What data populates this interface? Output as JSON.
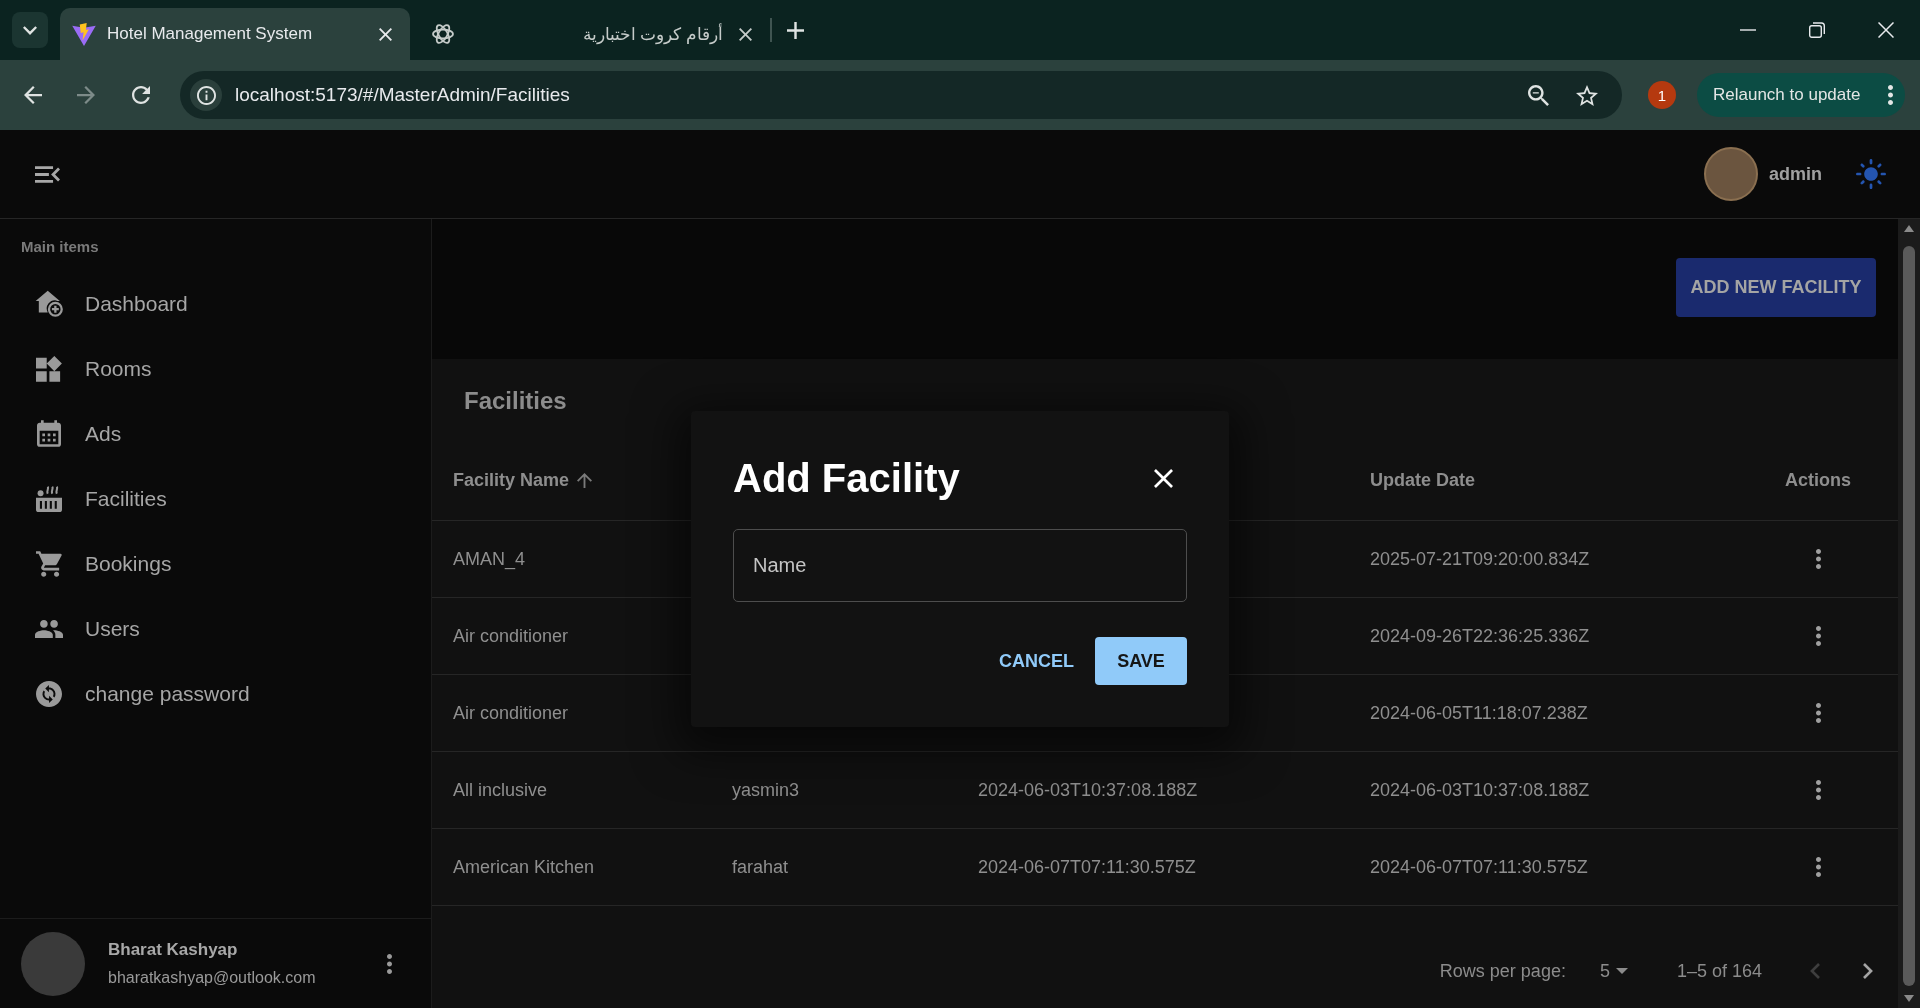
{
  "browser": {
    "tabs": [
      {
        "title": "Hotel Management System",
        "selected": true
      },
      {
        "title": "أرقام كروت اختبارية",
        "selected": false
      }
    ],
    "address": "localhost:5173/#/MasterAdmin/Facilities",
    "notification_badge": "1",
    "relaunch_button": "Relaunch to update"
  },
  "app_bar": {
    "user_name": "admin"
  },
  "sidebar": {
    "section_title": "Main items",
    "items": [
      {
        "label": "Dashboard",
        "selected": false
      },
      {
        "label": "Rooms",
        "selected": false
      },
      {
        "label": "Ads",
        "selected": false
      },
      {
        "label": "Facilities",
        "selected": false
      },
      {
        "label": "Bookings",
        "selected": false
      },
      {
        "label": "Users",
        "selected": false
      },
      {
        "label": "change password",
        "selected": false
      }
    ],
    "account": {
      "name": "Bharat Kashyap",
      "email": "bharatkashyap@outlook.com"
    }
  },
  "page": {
    "add_button": "ADD NEW FACILITY"
  },
  "table": {
    "title": "Facilities",
    "columns": {
      "facility_name": {
        "label": "Facility Name",
        "sorted_ascending": true
      },
      "update_date": {
        "label": "Update Date"
      },
      "actions": {
        "label": "Actions"
      }
    },
    "rows": [
      {
        "name": "AMAN_4",
        "update_date": "2025-07-21T09:20:00.834Z"
      },
      {
        "name": "Air conditioner",
        "update_date": "2024-09-26T22:36:25.336Z"
      },
      {
        "name": "Air conditioner",
        "update_date": "2024-06-05T11:18:07.238Z"
      },
      {
        "name": "All inclusive",
        "column_2": "yasmin3",
        "column_3": "2024-06-03T10:37:08.188Z",
        "update_date": "2024-06-03T10:37:08.188Z"
      },
      {
        "name": "American Kitchen",
        "column_2": "farahat",
        "column_3": "2024-06-07T07:11:30.575Z",
        "update_date": "2024-06-07T07:11:30.575Z"
      }
    ],
    "pagination": {
      "rows_per_page_label": "Rows per page:",
      "rows_per_page": "5",
      "range": "1–5 of 164",
      "previous_disabled": true,
      "next_disabled": false
    }
  },
  "dialog": {
    "title": "Add Facility",
    "field": {
      "placeholder": "Name"
    },
    "buttons": [
      {
        "label": "CANCEL",
        "kind": "text"
      },
      {
        "label": "SAVE",
        "kind": "contained"
      }
    ]
  }
}
